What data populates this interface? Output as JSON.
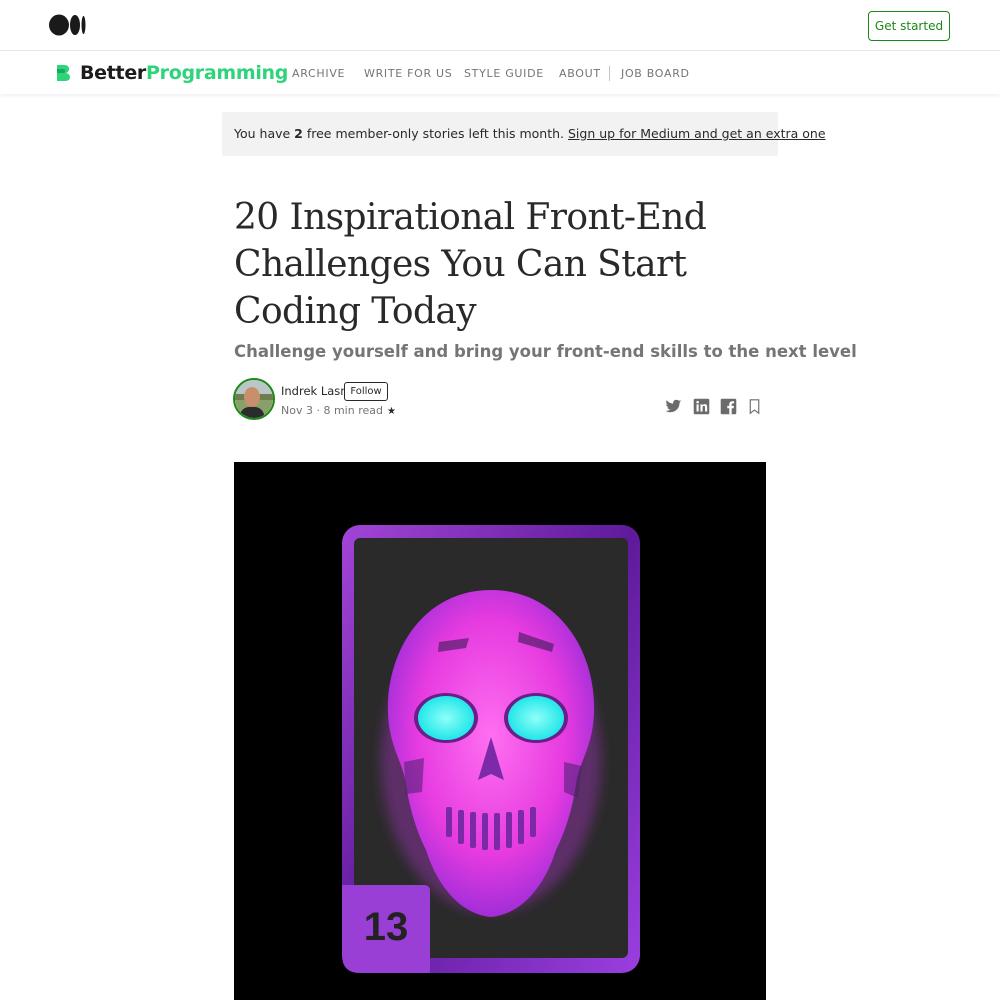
{
  "header": {
    "logo_icon": "medium-logo-icon",
    "get_started_label": "Get started"
  },
  "publication": {
    "name_part1": "Better",
    "name_part2": "Programming",
    "accent_color": "#2ed47a",
    "nav": [
      "ARCHIVE",
      "WRITE FOR US",
      "STYLE GUIDE",
      "ABOUT",
      "JOB BOARD"
    ]
  },
  "banner": {
    "prefix": "You have ",
    "count": "2",
    "suffix": " free member-only stories left this month. ",
    "link": "Sign up for Medium and get an extra one"
  },
  "article": {
    "title": "20 Inspirational Front-End Challenges You Can Start Coding Today",
    "subtitle": "Challenge yourself and bring your front-end skills to the next level",
    "author": "Indrek Lasn",
    "follow_label": "Follow",
    "date": "Nov 3",
    "separator": " · ",
    "read_time": "8 min read",
    "member_star": "★",
    "share_icons": [
      "twitter-icon",
      "linkedin-icon",
      "facebook-icon",
      "bookmark-icon"
    ]
  },
  "hero_image": {
    "card_number": "13",
    "card_color": "#8a2be2",
    "skull_color": "#ff4fe0",
    "eye_color": "#40f5ef"
  }
}
